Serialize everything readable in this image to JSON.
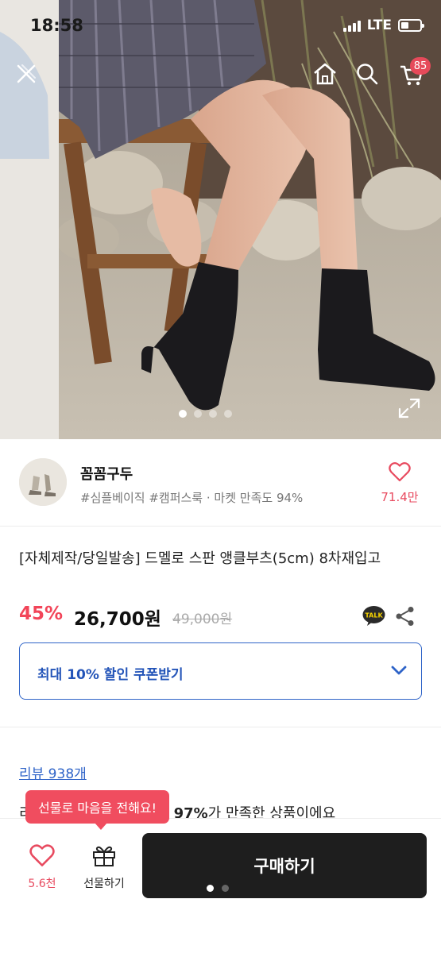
{
  "status_bar": {
    "time": "18:58",
    "network": "LTE"
  },
  "header": {
    "icons": [
      "close-icon",
      "home-icon",
      "search-icon",
      "cart-icon"
    ],
    "cart_badge": "85"
  },
  "gallery": {
    "slide_count": 4,
    "active_index": 0
  },
  "shop": {
    "name": "꼼꼼구두",
    "tags": "#심플베이직 #캠퍼스룩 · 마켓 만족도 94%",
    "like_count": "71.4만"
  },
  "product": {
    "title": "[자체제작/당일발송] 드멜로 스판 앵클부츠(5cm) 8차재입고",
    "discount": "45%",
    "price": "26,700원",
    "original_price": "49,000원",
    "talk_label": "TALK"
  },
  "coupon": {
    "label": "최대 10% 할인 쿠폰받기"
  },
  "review": {
    "link_label": "리뷰 938개",
    "satisfaction_prefix": "리",
    "satisfaction_percent": "97%",
    "satisfaction_suffix": "가 만족한 상품이에요"
  },
  "bottom_bar": {
    "tooltip": "선물로 마음을 전해요!",
    "like_count": "5.6천",
    "gift_label": "선물하기",
    "buy_label": "구매하기",
    "page_count": 2,
    "active_page": 0
  },
  "colors": {
    "accent": "#f24559",
    "link": "#2f64c8",
    "buy": "#1e1e1e"
  }
}
